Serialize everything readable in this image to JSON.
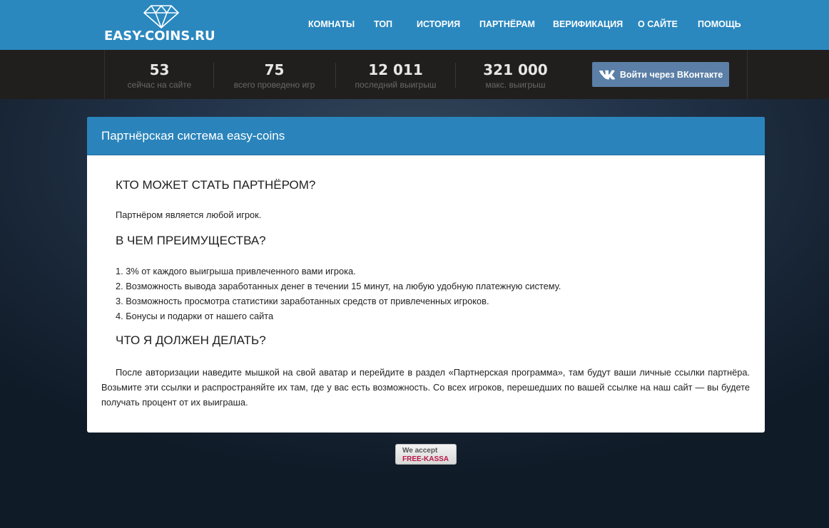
{
  "header": {
    "logo_text": "EASY-COINS.RU",
    "nav": [
      {
        "label": "КОМНАТЫ"
      },
      {
        "label": "ТОП"
      },
      {
        "label": "ИСТОРИЯ"
      },
      {
        "label": "ПАРТНЁРАМ"
      },
      {
        "label": "ВЕРИФИКАЦИЯ"
      },
      {
        "label": "О САЙТЕ"
      },
      {
        "label": "ПОМОЩЬ"
      }
    ]
  },
  "stats": [
    {
      "value": "53",
      "label": "сейчас на сайте"
    },
    {
      "value": "75",
      "label": "всего проведено игр"
    },
    {
      "value": "12 011",
      "label": "последний выигрыш"
    },
    {
      "value": "321 000",
      "label": "макс. выигрыш"
    }
  ],
  "login": {
    "icon": "vk-icon",
    "label": "Войти через ВКонтакте"
  },
  "panel": {
    "title": "Партнёрская система easy-coins",
    "h1": "КТО МОЖЕТ СТАТЬ ПАРТНЁРОМ?",
    "p1": "Партнёром является любой игрок.",
    "h2": "В ЧЕМ ПРЕИМУЩЕСТВА?",
    "benefits": [
      "1. 3% от каждого выигрыша привлеченного вами игрока.",
      "2. Возможность вывода заработанных денег в течении 15 минут, на любую удобную платежную систему.",
      "3. Возможность просмотра статистики заработанных средств от привлеченных игроков.",
      "4. Бонусы и подарки от нашего сайта"
    ],
    "h3": "ЧТО Я ДОЛЖЕН ДЕЛАТЬ?",
    "p3": "После авторизации наведите мышкой на свой аватар и перейдите в раздел «Партнерская программа», там будут ваши личные ссылки партнёра. Возьмите эти ссылки и распространяйте их там, где у вас есть возможность. Со всех игроков, перешедших по вашей ссылке на наш сайт — вы будете получать процент от их выиграша."
  },
  "badge": {
    "line1": "We accept",
    "line2": "FREE-KASSA"
  },
  "colors": {
    "header": "#2b88bf",
    "statsbar": "#211f1d",
    "panel_header": "#2a84bb",
    "vk_button": "#5b7fa6"
  }
}
